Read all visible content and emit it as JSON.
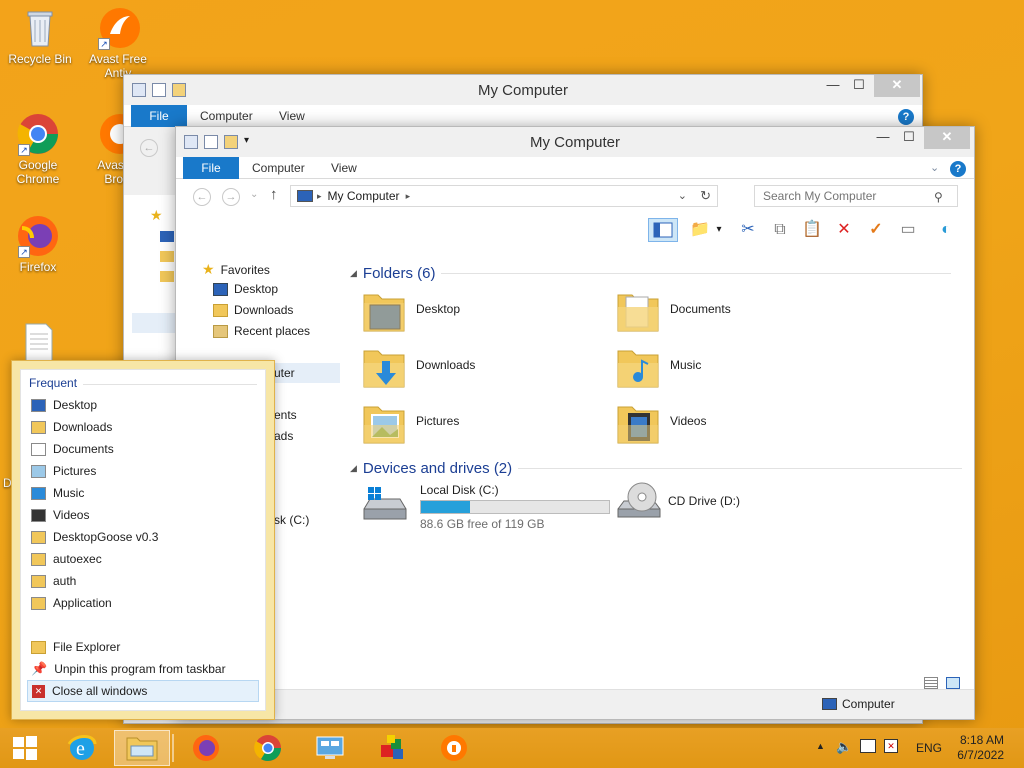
{
  "desktop": {
    "icons": [
      {
        "label": "Recycle Bin"
      },
      {
        "label": "Avast Free Antiv"
      },
      {
        "label": "Google Chrome"
      },
      {
        "label": "Avast S Brow"
      },
      {
        "label": "Firefox"
      },
      {
        "label": "D"
      }
    ]
  },
  "back_window": {
    "title": "My Computer",
    "tabs": [
      "File",
      "Computer",
      "View"
    ],
    "nav_fragments": [
      "uter",
      "ents",
      "ads",
      "sk (C:)"
    ]
  },
  "window": {
    "title": "My Computer",
    "controls": {
      "minimize": "—",
      "maximize": "☐",
      "close": "✕"
    },
    "tabs": [
      "File",
      "Computer",
      "View"
    ],
    "help": "?",
    "address": {
      "location": "My Computer"
    },
    "search": {
      "placeholder": "Search My Computer"
    },
    "nav_pane": {
      "favorites_label": "Favorites",
      "favorites": [
        "Desktop",
        "Downloads",
        "Recent places"
      ]
    },
    "folders_header": "Folders (6)",
    "folders": [
      "Desktop",
      "Documents",
      "Downloads",
      "Music",
      "Pictures",
      "Videos"
    ],
    "devices_header": "Devices and drives (2)",
    "local_disk": {
      "name": "Local Disk (C:)",
      "free_text": "88.6 GB free of 119 GB",
      "used_fraction": 0.26
    },
    "cd_drive": {
      "name": "CD Drive (D:)"
    },
    "status_text": "Computer"
  },
  "jumplist": {
    "header": "Frequent",
    "frequent": [
      "Desktop",
      "Downloads",
      "Documents",
      "Pictures",
      "Music",
      "Videos",
      "DesktopGoose v0.3",
      "autoexec",
      "auth",
      "Application"
    ],
    "tasks": [
      "File Explorer",
      "Unpin this program from taskbar",
      "Close all windows"
    ]
  },
  "taskbar": {
    "language": "ENG",
    "time": "8:18 AM",
    "date": "6/7/2022"
  },
  "colors": {
    "accent": "#1979ca",
    "desktop": "#f0a519",
    "folder": "#f1c75a"
  }
}
